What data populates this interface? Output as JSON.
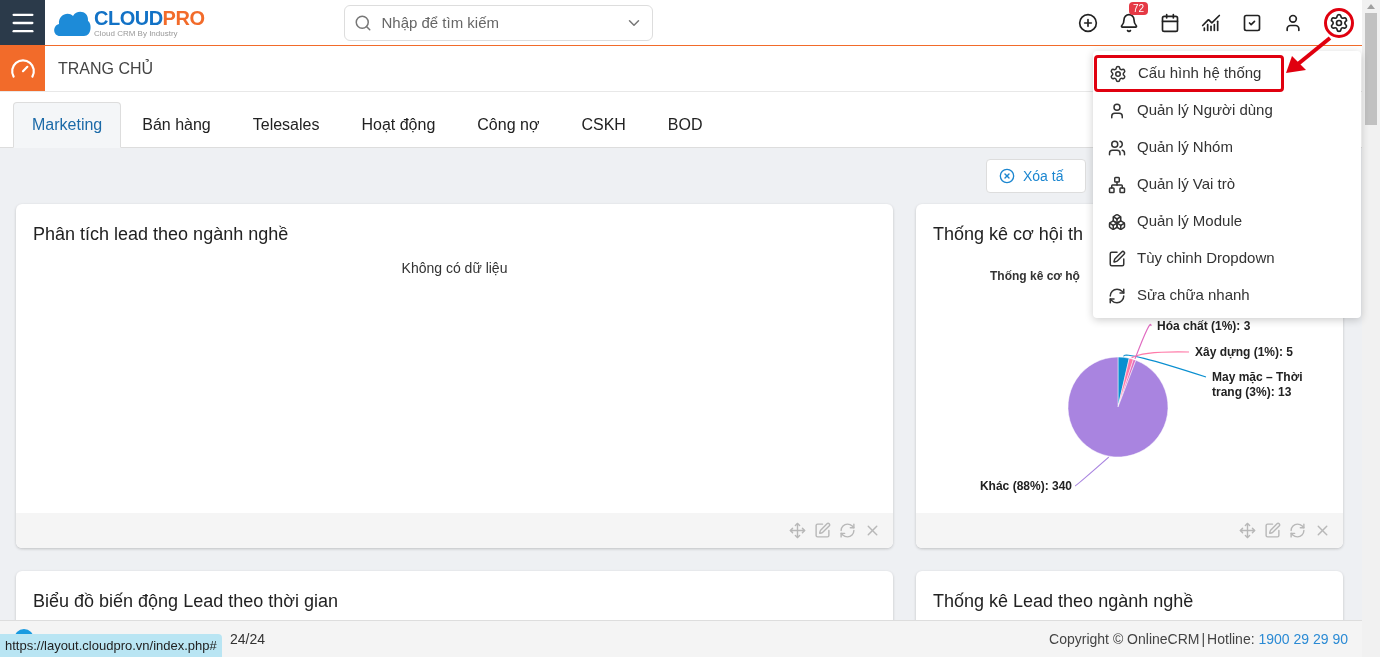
{
  "header": {
    "logo": {
      "text": "CLOUD",
      "accent": "PRO",
      "tagline": "Cloud CRM By Industry"
    },
    "search": {
      "placeholder": "Nhập để tìm kiếm"
    },
    "notification_count": "72",
    "settings_annotated": true
  },
  "breadcrumb": {
    "title": "TRANG CHỦ"
  },
  "tabs": [
    {
      "label": "Marketing",
      "selected": true
    },
    {
      "label": "Bán hàng",
      "selected": false
    },
    {
      "label": "Telesales",
      "selected": false
    },
    {
      "label": "Hoạt động",
      "selected": false
    },
    {
      "label": "Công nợ",
      "selected": false
    },
    {
      "label": "CSKH",
      "selected": false
    },
    {
      "label": "BOD",
      "selected": false
    }
  ],
  "toolbar": {
    "clear_button": "Xóa tấ"
  },
  "widgets": [
    {
      "title": "Phân tích lead theo ngành nghề",
      "kind": "empty",
      "message": "Không có dữ liệu"
    },
    {
      "title": "Thống kê cơ hội th",
      "kind": "pie",
      "chart_data": {
        "type": "pie",
        "title": "Thống kê cơ hộ",
        "categories": [
          "May mặc – Thời trang (3%): 13",
          "Xây dựng (1%): 5",
          "Hóa chất (1%): 3",
          "Khác (88%): 340"
        ],
        "values": [
          13,
          5,
          3,
          340
        ]
      }
    }
  ],
  "widgets_row2": [
    {
      "title": "Biểu đồ biến động Lead theo thời gian"
    },
    {
      "title": "Thống kê Lead theo ngành nghề"
    }
  ],
  "settings_menu": {
    "items": [
      {
        "label": "Cấu hình hệ thống",
        "annotated": true
      },
      {
        "label": "Quản lý Người dùng",
        "annotated": false
      },
      {
        "label": "Quản lý Nhóm",
        "annotated": false
      },
      {
        "label": "Quản lý Vai trò",
        "annotated": false
      },
      {
        "label": "Quản lý Module",
        "annotated": false
      },
      {
        "label": "Tùy chỉnh Dropdown",
        "annotated": false
      },
      {
        "label": "Sửa chữa nhanh",
        "annotated": false
      }
    ]
  },
  "footer": {
    "status": "24/24",
    "copyright": "Copyright © OnlineCRM",
    "separator": "|",
    "hotline_label": "Hotline:",
    "hotline": "1900 29 29 90",
    "link_preview": "https://layout.cloudpro.vn/index.php#"
  }
}
